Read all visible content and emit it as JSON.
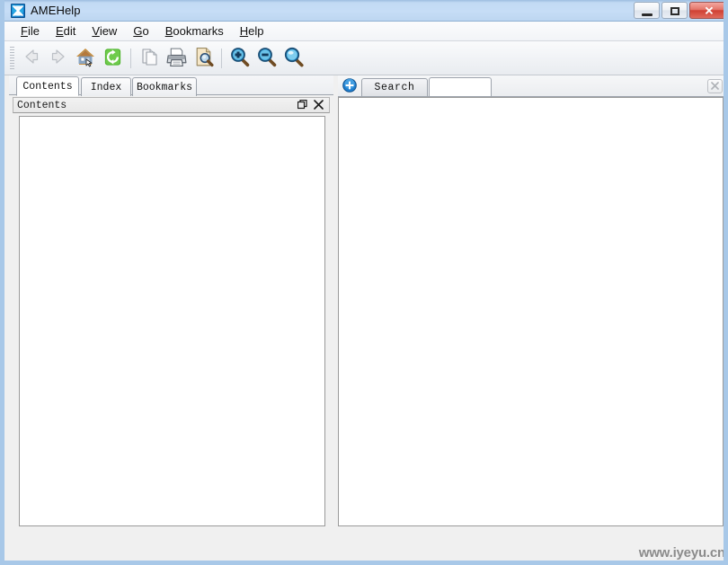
{
  "window": {
    "title": "AMEHelp",
    "app_icon": "ame-star-icon",
    "controls": {
      "minimize": "minimize-button",
      "maximize": "maximize-button",
      "close": "✕"
    }
  },
  "menubar": {
    "items": [
      {
        "label": "File",
        "mnemonic": "F"
      },
      {
        "label": "Edit",
        "mnemonic": "E"
      },
      {
        "label": "View",
        "mnemonic": "V"
      },
      {
        "label": "Go",
        "mnemonic": "G"
      },
      {
        "label": "Bookmarks",
        "mnemonic": "B"
      },
      {
        "label": "Help",
        "mnemonic": "H"
      }
    ]
  },
  "toolbar": {
    "buttons": [
      {
        "icon": "back-arrow-icon",
        "label": "Back",
        "enabled": false
      },
      {
        "icon": "forward-arrow-icon",
        "label": "Forward",
        "enabled": false
      },
      {
        "icon": "home-icon",
        "label": "Home",
        "enabled": true
      },
      {
        "icon": "refresh-icon",
        "label": "Refresh",
        "enabled": true
      },
      {
        "icon": "copy-page-icon",
        "label": "Copy",
        "enabled": false
      },
      {
        "icon": "print-icon",
        "label": "Print",
        "enabled": true
      },
      {
        "icon": "print-preview-icon",
        "label": "Print Preview",
        "enabled": true
      },
      {
        "icon": "zoom-in-icon",
        "label": "Zoom In",
        "enabled": true
      },
      {
        "icon": "zoom-out-icon",
        "label": "Zoom Out",
        "enabled": true
      },
      {
        "icon": "find-icon",
        "label": "Find",
        "enabled": true
      }
    ]
  },
  "left_panel": {
    "tabs": [
      {
        "label": "Contents",
        "active": true
      },
      {
        "label": "Index",
        "active": false
      },
      {
        "label": "Bookmarks",
        "active": false
      }
    ],
    "dock": {
      "title": "Contents",
      "float_icon": "float-window-icon",
      "close_icon": "✕"
    },
    "tree_items": []
  },
  "right_panel": {
    "add_tab_icon": "plus-icon",
    "tabs": [
      {
        "label": "Search",
        "active": false
      },
      {
        "label": "",
        "active": true
      }
    ],
    "close_tab_icon": "✕",
    "document_content": ""
  },
  "statusbar": {
    "watermark": "www.iyeyu.cn",
    "message": ""
  },
  "colors": {
    "titlebar": "#c2daf4",
    "window_border": "#a8c8e8",
    "chrome": "#f0f0f0",
    "accent_blue": "#1f7fd0",
    "close_red": "#cf4033",
    "refresh_green": "#4caf30",
    "watermark_gray": "#8b8b8b"
  }
}
